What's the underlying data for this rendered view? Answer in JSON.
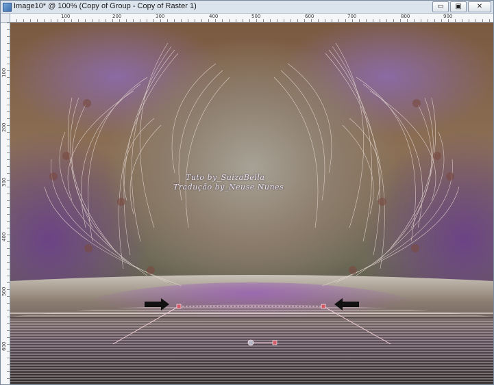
{
  "window": {
    "title": "Image10* @ 100% (Copy of Group - Copy of Raster 1)",
    "minimize_glyph": "▭",
    "restore_glyph": "▣",
    "close_glyph": "✕"
  },
  "ruler": {
    "top_ticks": [
      "100",
      "200",
      "300",
      "400",
      "500",
      "600",
      "700",
      "800",
      "900"
    ],
    "left_ticks": [
      "100",
      "200",
      "300",
      "400",
      "500",
      "600"
    ]
  },
  "canvas": {
    "watermark_line1": "Tuto by_SuizaBella",
    "watermark_line2": "Tradução by_Neuse Nunes"
  },
  "colors": {
    "arrow": "#111111",
    "guide_line": "#f2d0d8",
    "node": "#d65a6a",
    "pivot": "#b8b8c8"
  }
}
